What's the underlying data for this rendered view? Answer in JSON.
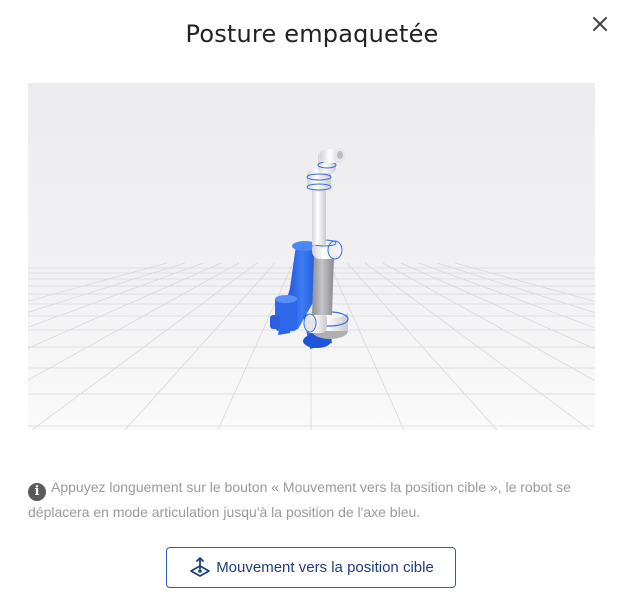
{
  "dialog": {
    "title": "Posture empaquetée",
    "close_icon": "close-icon",
    "info_icon": "info-icon",
    "info_text": "Appuyez longuement sur le bouton « Mouvement vers la position cible », le robot se déplacera en mode articulation jusqu'à la position de l'axe bleu.",
    "move_button": {
      "label": "Mouvement vers la position cible",
      "icon": "move-target-icon"
    }
  },
  "colors": {
    "accent_blue": "#2f6ce5",
    "button_border": "#2f5fa8",
    "button_text": "#1c3e7c",
    "hint_text": "#9a9a9a",
    "viewport_bg": "#efeff1"
  }
}
